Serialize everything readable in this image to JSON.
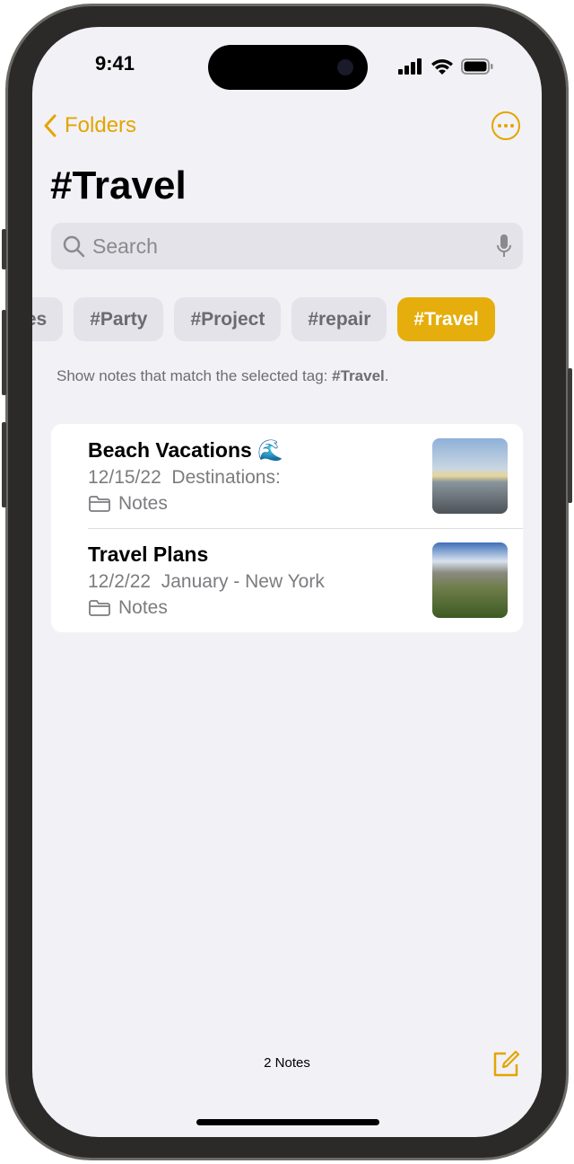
{
  "status_bar": {
    "time": "9:41"
  },
  "nav": {
    "back_label": "Folders",
    "more_icon": "ellipsis-circle-icon"
  },
  "page_title": "#Travel",
  "search": {
    "placeholder": "Search"
  },
  "tags": [
    {
      "label": "#Recipes",
      "visible_text": "es"
    },
    {
      "label": "#Party"
    },
    {
      "label": "#Project"
    },
    {
      "label": "#repair"
    },
    {
      "label": "#Travel",
      "selected": true
    }
  ],
  "hint": {
    "prefix": "Show notes that match the selected tag: ",
    "tag": "#Travel",
    "suffix": "."
  },
  "notes": [
    {
      "title": "Beach Vacations 🌊",
      "date": "12/15/22",
      "preview": "Destinations:",
      "folder": "Notes"
    },
    {
      "title": "Travel Plans",
      "date": "12/2/22",
      "preview": "January - New York",
      "folder": "Notes"
    }
  ],
  "footer": {
    "count": "2 Notes"
  },
  "colors": {
    "accent": "#e3a500",
    "background": "#f2f1f6"
  }
}
